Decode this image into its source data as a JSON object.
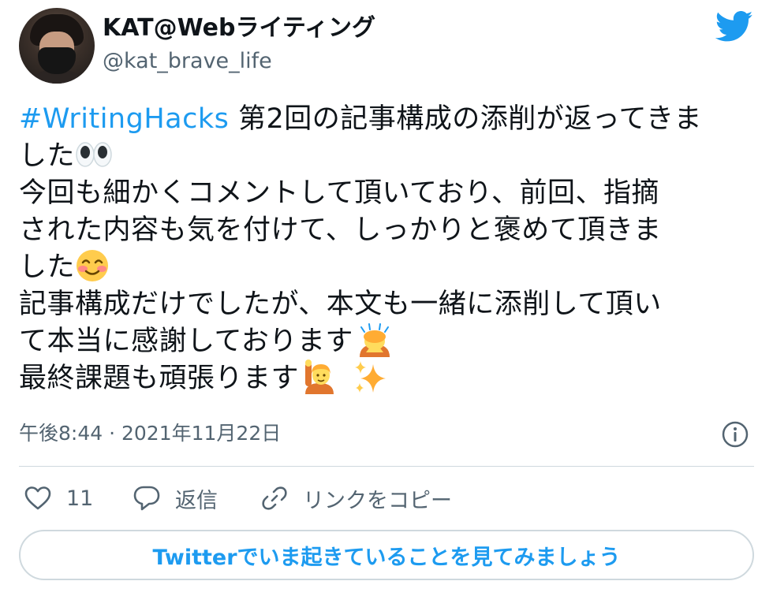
{
  "tweet": {
    "author": {
      "display_name": "KAT@Webライティング",
      "handle": "@kat_brave_life"
    },
    "text": {
      "hashtag": "#WritingHacks",
      "line1_rest": " 第2回の記事構成の添削が返ってきま",
      "line2": "した",
      "line3": "今回も細かくコメントして頂いており、前回、指摘",
      "line4": "された内容も気を付けて、しっかりと褒めて頂きま",
      "line5": "した",
      "line6": "記事構成だけでしたが、本文も一緒に添削して頂い",
      "line7": "て本当に感謝しております",
      "line8": "最終課題も頑張ります"
    },
    "emojis": [
      "eyes-emoji",
      "smiling-blush-emoji",
      "bowing-person-emoji",
      "raising-hand-person-emoji",
      "sparkles-emoji"
    ],
    "timestamp": "午後8:44 · 2021年11月22日",
    "actions": {
      "like_count": "11",
      "reply_label": "返信",
      "copy_link_label": "リンクをコピー"
    },
    "cta_label": "Twitterでいま起きていることを見てみましょう"
  },
  "colors": {
    "accent": "#1d9bf0",
    "secondary_text": "#536471",
    "border": "#cfd9de"
  }
}
